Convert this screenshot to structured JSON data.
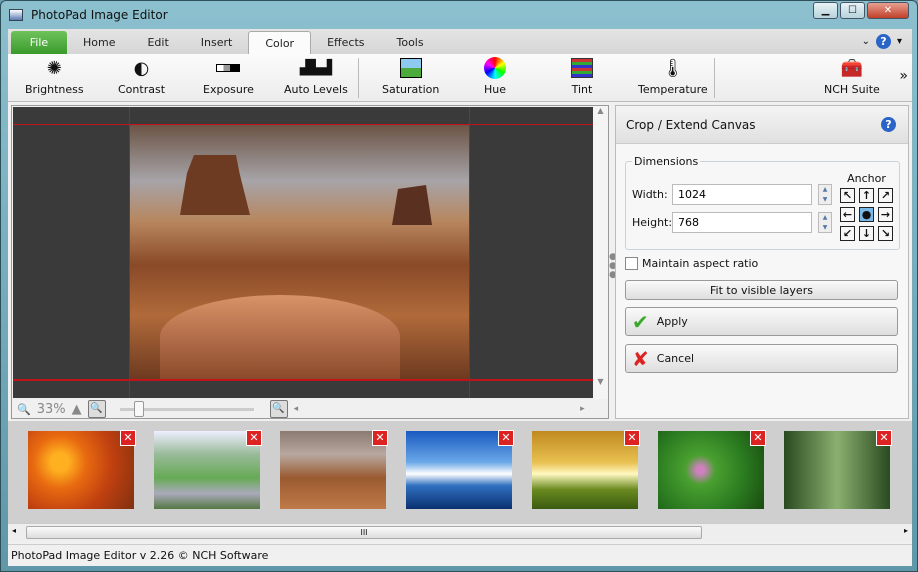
{
  "window": {
    "title": "PhotoPad Image Editor"
  },
  "tabs": [
    "File",
    "Home",
    "Edit",
    "Insert",
    "Color",
    "Effects",
    "Tools"
  ],
  "active_tab": "Color",
  "toolbar": [
    {
      "label": "Brightness",
      "icon": "brightness-icon"
    },
    {
      "label": "Contrast",
      "icon": "contrast-icon"
    },
    {
      "label": "Exposure",
      "icon": "exposure-icon"
    },
    {
      "label": "Auto Levels",
      "icon": "auto-levels-icon"
    },
    {
      "label": "Saturation",
      "icon": "saturation-icon"
    },
    {
      "label": "Hue",
      "icon": "hue-icon"
    },
    {
      "label": "Tint",
      "icon": "tint-icon"
    },
    {
      "label": "Temperature",
      "icon": "temperature-icon"
    },
    {
      "label": "NCH Suite",
      "icon": "nch-suite-icon"
    }
  ],
  "zoom": {
    "level": "33%"
  },
  "panel": {
    "title": "Crop / Extend Canvas",
    "group": "Dimensions",
    "width_label": "Width:",
    "width": "1024",
    "height_label": "Height:",
    "height": "768",
    "anchor": "Anchor",
    "maintain": "Maintain aspect ratio",
    "maintain_checked": false,
    "fit": "Fit to visible layers",
    "apply": "Apply",
    "cancel": "Cancel"
  },
  "thumbnails": [
    "flowers",
    "stream",
    "desert-buttes",
    "ocean-pier",
    "autumn-tree",
    "green-flowers",
    "forest-path"
  ],
  "status": "PhotoPad Image Editor v 2.26 © NCH Software"
}
